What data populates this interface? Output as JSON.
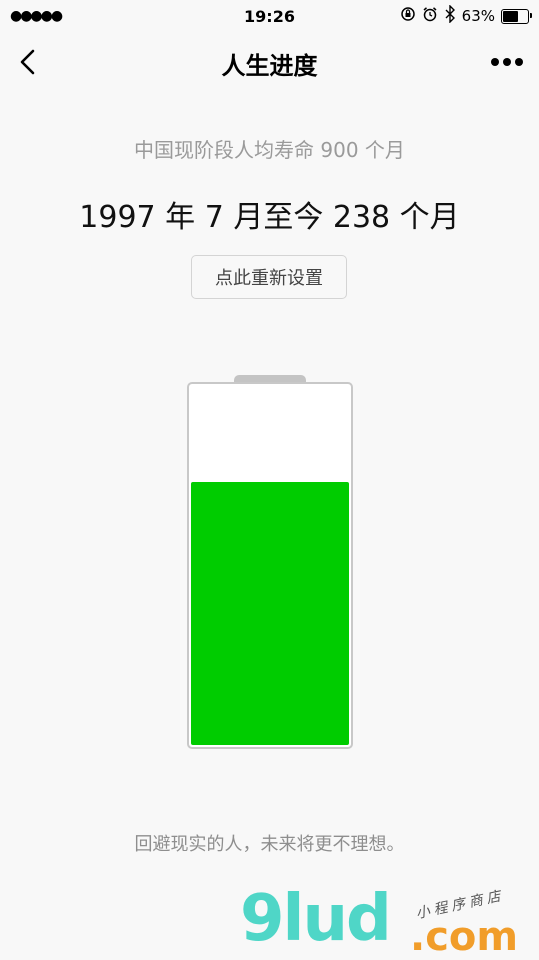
{
  "status_bar": {
    "signal": "●●●●●",
    "time": "19:26",
    "battery_percent": "63%",
    "battery_level": 0.63,
    "icons": [
      "orientation-lock-icon",
      "alarm-icon",
      "bluetooth-icon",
      "battery-icon"
    ]
  },
  "nav": {
    "title": "人生进度",
    "back_icon": "chevron-left-icon",
    "more_icon": "more-dots-icon"
  },
  "main": {
    "lifespan_text": "中国现阶段人均寿命 900 个月",
    "elapsed_text": "1997 年 7 月至今 238 个月",
    "reset_label": "点此重新设置",
    "remaining_fraction": 0.7356,
    "fill_color": "#00cc00"
  },
  "footer": {
    "quote": "回避现实的人，未来将更不理想。"
  },
  "watermark": {
    "main": "9lud",
    "tld": ".com",
    "sub": "小程序商店"
  }
}
